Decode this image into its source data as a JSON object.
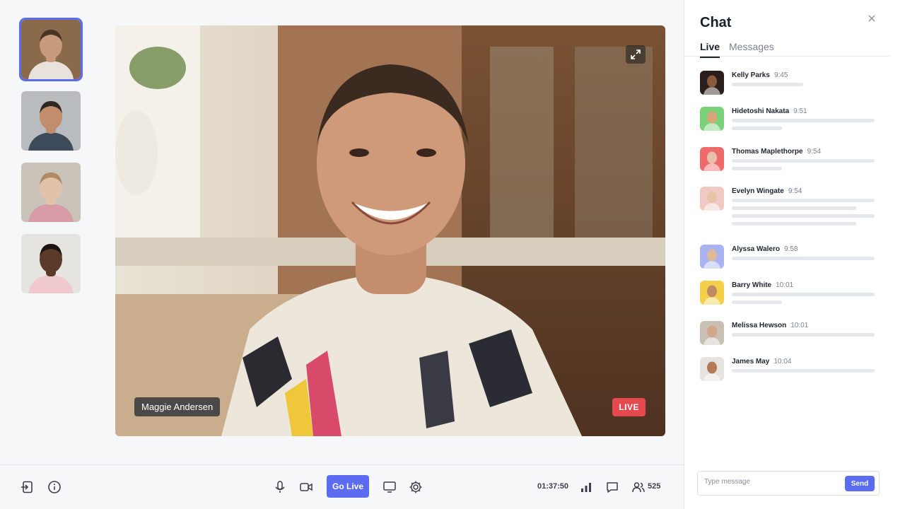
{
  "participants": [
    {
      "name": "participant-1",
      "skin": "#c89a7c",
      "hair": "#4a3424",
      "bg": "#8a6a4a",
      "shirt": "#e8e2da",
      "active": true
    },
    {
      "name": "participant-2",
      "skin": "#c18d6c",
      "hair": "#2e2620",
      "bg": "#b9bcbf",
      "shirt": "#3d4a5c",
      "active": false
    },
    {
      "name": "participant-3",
      "skin": "#e2c2aa",
      "hair": "#b08a62",
      "bg": "#c9c3ba",
      "shirt": "#d89aa4",
      "active": false
    },
    {
      "name": "participant-4",
      "skin": "#5a3a28",
      "hair": "#1b1410",
      "bg": "#e6e4e0",
      "shirt": "#efc9cd",
      "active": false
    }
  ],
  "stage": {
    "speaker_name": "Maggie Andersen",
    "live_label": "LIVE"
  },
  "toolbar": {
    "go_live_label": "Go Live",
    "timer": "01:37:50",
    "participant_count": "525"
  },
  "chat": {
    "title": "Chat",
    "tabs": [
      "Live",
      "Messages"
    ],
    "messages": [
      {
        "name": "Kelly Parks",
        "time": "9:45",
        "lines": [
          0.5
        ],
        "color": "#2a1f1a",
        "skin": "#8a5a3c"
      },
      {
        "name": "Hidetoshi Nakata",
        "time": "9:51",
        "lines": [
          1.0,
          0.35
        ],
        "color": "#7bd17a",
        "skin": "#d8a47a"
      },
      {
        "name": "Thomas Maplethorpe",
        "time": "9:54",
        "lines": [
          1.0,
          0.35
        ],
        "color": "#ef6b6b",
        "skin": "#e6c0a8"
      },
      {
        "name": "Evelyn Wingate",
        "time": "9:54",
        "lines": [
          1.0,
          0.87,
          1.0,
          0.87
        ],
        "color": "#f1c9c4",
        "skin": "#eac2a8"
      },
      {
        "name": "Alyssa Walero",
        "time": "9:58",
        "lines": [
          1.0
        ],
        "color": "#a9b3f0",
        "skin": "#e0b89c"
      },
      {
        "name": "Barry White",
        "time": "10:01",
        "lines": [
          1.0,
          0.35
        ],
        "color": "#f3cf4a",
        "skin": "#c28a64"
      },
      {
        "name": "Melissa Hewson",
        "time": "10:01",
        "lines": [
          1.0
        ],
        "color": "#c9bfb4",
        "skin": "#d2a68a"
      },
      {
        "name": "James May",
        "time": "10:04",
        "lines": [
          1.0
        ],
        "color": "#e7e3de",
        "skin": "#b47a58"
      }
    ],
    "composer_placeholder": "Type message",
    "send_label": "Send"
  },
  "colors": {
    "accent": "#5b6cf0",
    "live": "#e5484d"
  }
}
